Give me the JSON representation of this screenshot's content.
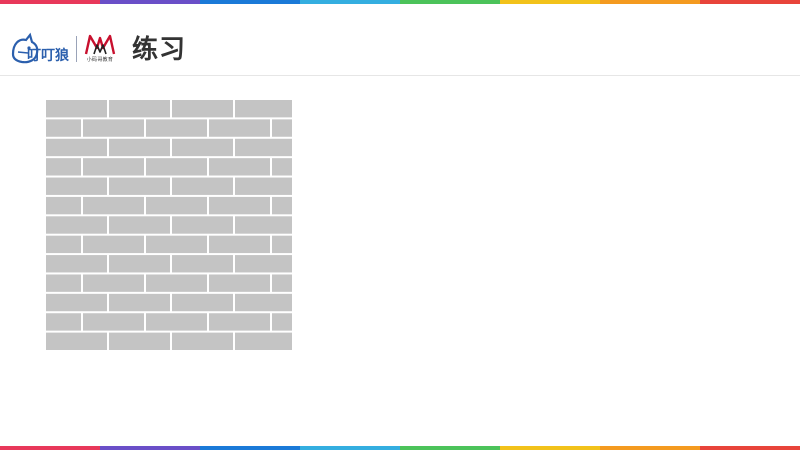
{
  "slide": {
    "title": "练习",
    "logos": {
      "left_logo_text": "叮叮狼",
      "right_logo_text": "小码哥教育"
    }
  },
  "stripe_colors": [
    "#e8385a",
    "#6a4fc8",
    "#1a7ad8",
    "#34aee0",
    "#4cc35a",
    "#f2c21a",
    "#f49a1f",
    "#e8443a"
  ],
  "brick_wall": {
    "brick_color": "#c4c4c4",
    "mortar_color": "#ffffff",
    "rows": 13
  }
}
